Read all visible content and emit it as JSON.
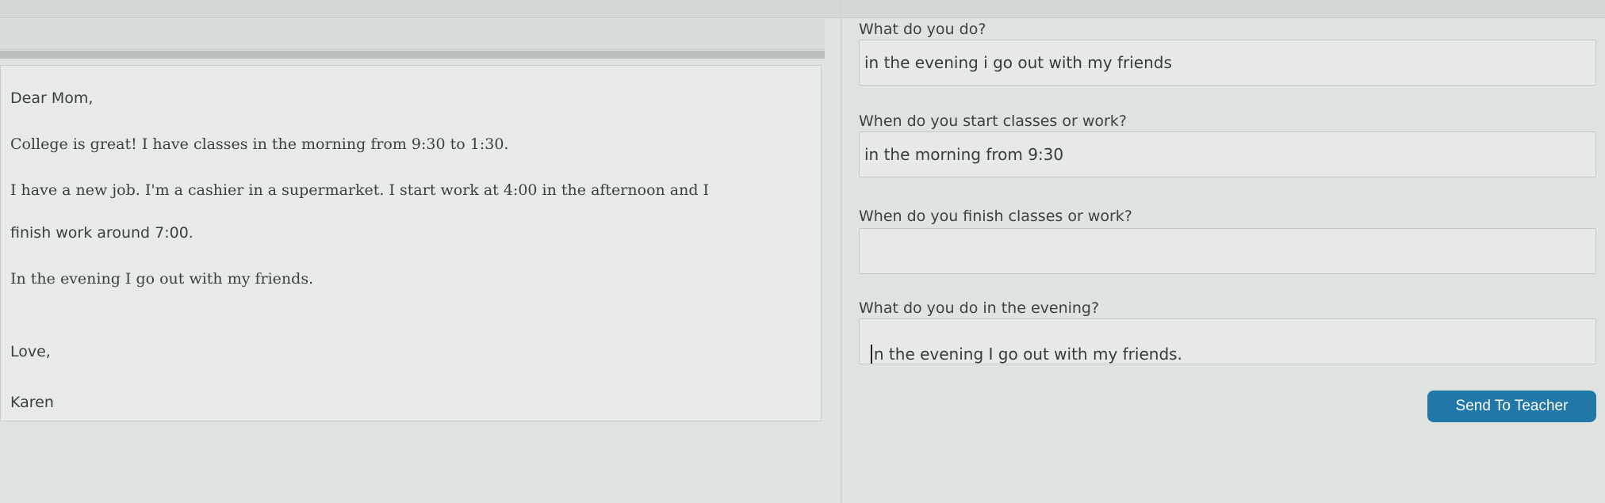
{
  "letter": {
    "greeting": "Dear Mom,",
    "line1": "College is great! I have classes in the morning from 9:30 to 1:30.",
    "line2": "I have a new job. I'm a cashier in a supermarket. I start work at 4:00 in the afternoon and I",
    "line3": "finish work around 7:00.",
    "line4": "In the evening I go out with my friends.",
    "closing": "Love,",
    "signature": "Karen"
  },
  "questions": [
    {
      "question": "What do you do?",
      "answer": "in the evening i go out with my friends"
    },
    {
      "question": "When do you start classes or work?",
      "answer": "in the morning from 9:30"
    },
    {
      "question": "When do you finish classes or work?",
      "answer": ""
    },
    {
      "question": "What do you do in the evening?",
      "answer": "In the evening I go out with my friends."
    }
  ],
  "send_button": {
    "label": "Send To Teacher",
    "color": "#2178a8"
  },
  "colors": {
    "background": "#dfe3df",
    "field": "#e6e9e5"
  }
}
